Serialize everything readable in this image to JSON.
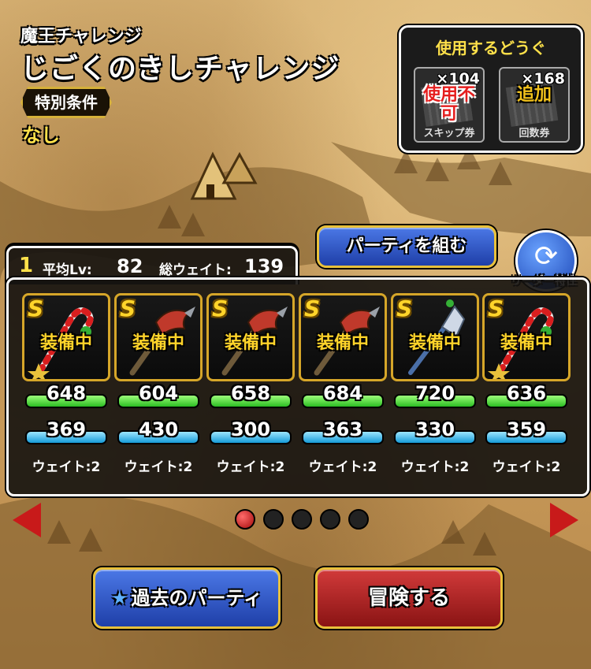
{
  "header": {
    "subtitle": "魔王チャレンジ",
    "title": "じごくのきしチャレンジ",
    "condition_label": "特別条件",
    "condition_value": "なし"
  },
  "tools": {
    "title": "使用するどうぐ",
    "items": [
      {
        "count": "×104",
        "status": "使用不可",
        "name": "スキップ券",
        "status_color": "#e51e1e"
      },
      {
        "count": "×168",
        "status": "追加",
        "name": "回数券",
        "status_color": "#f2c21b"
      }
    ]
  },
  "buttons": {
    "party": "パーティを組む",
    "leader": "リーダー特性",
    "past_party": "過去のパーティ",
    "adventure": "冒険する"
  },
  "party": {
    "number": "1",
    "avg_label": "平均Lv:",
    "avg_value": "82",
    "weight_label": "総ウェイト:",
    "weight_value": "139",
    "members": [
      {
        "rank": "S",
        "status": "装備中",
        "hp": "648",
        "mp": "369",
        "weight": "ウェイト:2",
        "weapon_icon": "candy-cane-staff-icon"
      },
      {
        "rank": "S",
        "status": "装備中",
        "hp": "604",
        "mp": "430",
        "weight": "ウェイト:2",
        "weapon_icon": "dragon-spear-icon"
      },
      {
        "rank": "S",
        "status": "装備中",
        "hp": "658",
        "mp": "300",
        "weight": "ウェイト:2",
        "weapon_icon": "dragon-spear-icon"
      },
      {
        "rank": "S",
        "status": "装備中",
        "hp": "684",
        "mp": "363",
        "weight": "ウェイト:2",
        "weapon_icon": "dragon-spear-icon"
      },
      {
        "rank": "S",
        "status": "装備中",
        "hp": "720",
        "mp": "330",
        "weight": "ウェイト:2",
        "weapon_icon": "ice-spear-icon"
      },
      {
        "rank": "S",
        "status": "装備中",
        "hp": "636",
        "mp": "359",
        "weight": "ウェイト:2",
        "weapon_icon": "candy-cane-staff-icon"
      }
    ]
  },
  "pagination": {
    "total": 5,
    "active": 1
  }
}
